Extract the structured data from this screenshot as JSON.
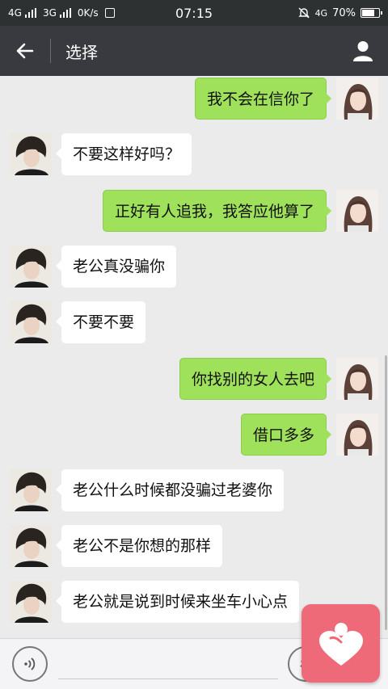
{
  "status_bar": {
    "network1": "4G",
    "network2": "3G",
    "speed": "0K/s",
    "time": "07:15",
    "network3": "4G",
    "battery": "70%",
    "battery_level": 0.7
  },
  "header": {
    "title": "选择",
    "back_icon": "back-arrow-icon",
    "profile_icon": "person-icon"
  },
  "messages": [
    {
      "side": "right",
      "text": "我不会在信你了"
    },
    {
      "side": "left",
      "text": "不要这样好吗？"
    },
    {
      "side": "right",
      "text": "正好有人追我，我答应他算了"
    },
    {
      "side": "left",
      "text": "老公真没骗你"
    },
    {
      "side": "left",
      "text": "不要不要"
    },
    {
      "side": "right",
      "text": "你找别的女人去吧"
    },
    {
      "side": "right",
      "text": "借口多多"
    },
    {
      "side": "left",
      "text": "老公什么时候都没骗过老婆你"
    },
    {
      "side": "left",
      "text": "老公不是你想的那样"
    },
    {
      "side": "left",
      "text": "老公就是说到时候来坐车小心点"
    }
  ],
  "input_bar": {
    "voice_icon": "voice-icon",
    "emoji_icon": "emoji-icon",
    "value": ""
  },
  "overlay": {
    "icon": "heart-person-icon",
    "color": "#ee6a78"
  },
  "colors": {
    "title_bar": "#393a3f",
    "status_bar": "#2e3132",
    "chat_background": "#ebebeb",
    "sent_bubble": "#9fe15b",
    "received_bubble": "#ffffff"
  }
}
